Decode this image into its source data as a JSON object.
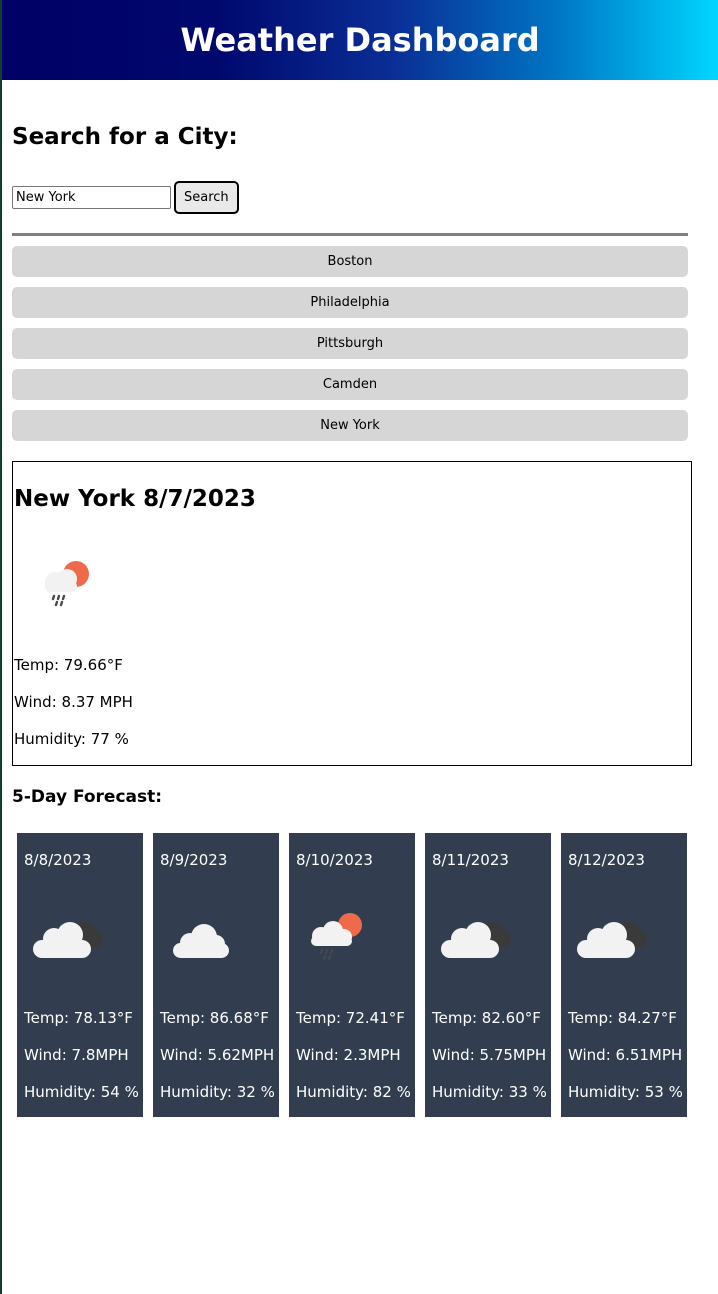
{
  "header": {
    "title": "Weather Dashboard"
  },
  "search": {
    "title": "Search for a City:",
    "input_value": "New York",
    "button_label": "Search"
  },
  "history": [
    "Boston",
    "Philadelphia",
    "Pittsburgh",
    "Camden",
    "New York"
  ],
  "current": {
    "title": "New York 8/7/2023",
    "icon": "rain-cloud-sun-icon",
    "temp": "Temp: 79.66°F",
    "wind": "Wind: 8.37 MPH",
    "humidity": "Humidity: 77 %"
  },
  "forecast": {
    "title": "5-Day Forecast:",
    "days": [
      {
        "date": "8/8/2023",
        "icon": "broken-clouds-icon",
        "temp": "Temp: 78.13°F",
        "wind": "Wind: 7.8MPH",
        "humidity": "Humidity: 54 %"
      },
      {
        "date": "8/9/2023",
        "icon": "cloud-icon",
        "temp": "Temp: 86.68°F",
        "wind": "Wind: 5.62MPH",
        "humidity": "Humidity: 32 %"
      },
      {
        "date": "8/10/2023",
        "icon": "rain-cloud-sun-icon",
        "temp": "Temp: 72.41°F",
        "wind": "Wind: 2.3MPH",
        "humidity": "Humidity: 82 %"
      },
      {
        "date": "8/11/2023",
        "icon": "broken-clouds-icon",
        "temp": "Temp: 82.60°F",
        "wind": "Wind: 5.75MPH",
        "humidity": "Humidity: 33 %"
      },
      {
        "date": "8/12/2023",
        "icon": "broken-clouds-icon",
        "temp": "Temp: 84.27°F",
        "wind": "Wind: 6.51MPH",
        "humidity": "Humidity: 53 %"
      }
    ]
  },
  "colors": {
    "header_gradient_start": "#000066",
    "header_gradient_end": "#00d6ff",
    "card_background": "#323d4f",
    "history_button": "#d6d6d6"
  }
}
